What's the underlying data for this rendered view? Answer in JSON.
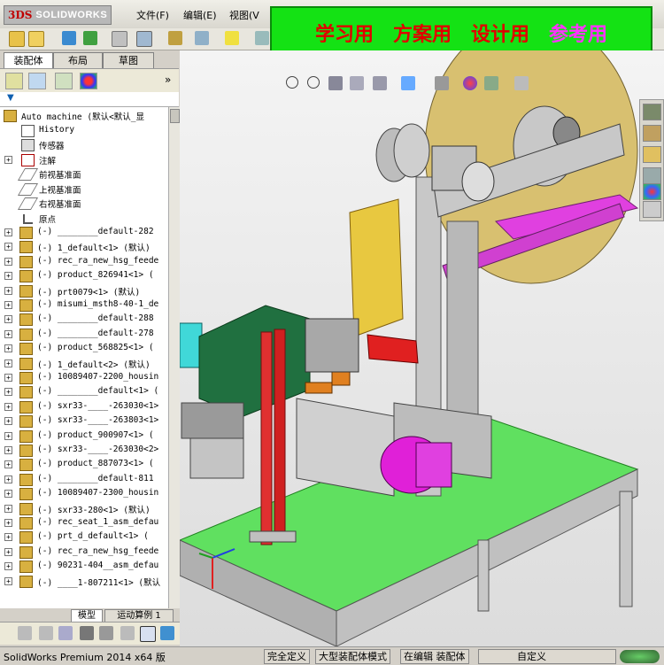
{
  "app": {
    "brand_prefix": "3DS",
    "brand_name": "SOLIDWORKS"
  },
  "menu": [
    "文件(F)",
    "编辑(E)",
    "视图(V"
  ],
  "banner": {
    "items": [
      {
        "text": "学习用",
        "color": "#e00000"
      },
      {
        "text": "方案用",
        "color": "#e00000"
      },
      {
        "text": "设计用",
        "color": "#e00000"
      },
      {
        "text": "参考用",
        "color": "#ff33ff"
      }
    ]
  },
  "pane_tabs": [
    "装配体",
    "布局",
    "草图"
  ],
  "pane_expand": "»",
  "filter_symbol": "▼",
  "tree": {
    "root": "Auto machine  (默认<默认_显",
    "items": [
      {
        "text": "History",
        "icon": "history-icon"
      },
      {
        "text": "传感器",
        "icon": "sensor-icon"
      },
      {
        "text": "注解",
        "icon": "annotation-icon",
        "expand": "+"
      },
      {
        "text": "前视基准面",
        "icon": "plane-icon"
      },
      {
        "text": "上视基准面",
        "icon": "plane-icon"
      },
      {
        "text": "右视基准面",
        "icon": "plane-icon"
      },
      {
        "text": "原点",
        "icon": "origin-icon"
      }
    ],
    "components": [
      "(-) ________default-282",
      "(-) 1_default<1> (默认)",
      "(-) rec_ra_new_hsg_feede",
      "(-) product_826941<1> (",
      "(-) prt0079<1> (默认)",
      "(-) misumi_msth8-40-1_de",
      "(-) ________default-288",
      "(-) ________default-278",
      "(-) product_568825<1> (",
      "(-) 1_default<2> (默认)",
      "(-) 10089407-2200_housin",
      "(-) ________default<1> (",
      "(-) sxr33-____-263030<1>",
      "(-) sxr33-____-263803<1>",
      "(-) product_900907<1> (",
      "(-) sxr33-____-263030<2>",
      "(-) product_887073<1> (",
      "(-) ________default-811",
      "(-) 10089407-2300_housin",
      "(-) sxr33-280<1> (默认)",
      "(-) rec_seat_1_asm_defau",
      "(-) prt_d_default<1> (",
      "(-) rec_ra_new_hsg_feede",
      "(-) 90231-404__asm_defau",
      "(-) ____1-807211<1> (默认"
    ]
  },
  "bottom_tabs": [
    "模型",
    "运动算例 1"
  ],
  "status": {
    "product": "SolidWorks Premium 2014 x64 版",
    "defined": "完全定义",
    "mode": "大型装配体模式",
    "editing": "在编辑 装配体",
    "custom": "自定义"
  },
  "colors": {
    "banner_bg": "#14e214",
    "tree_icon_part": "#d8b040",
    "viewport_bg": "#e8e8e8"
  }
}
